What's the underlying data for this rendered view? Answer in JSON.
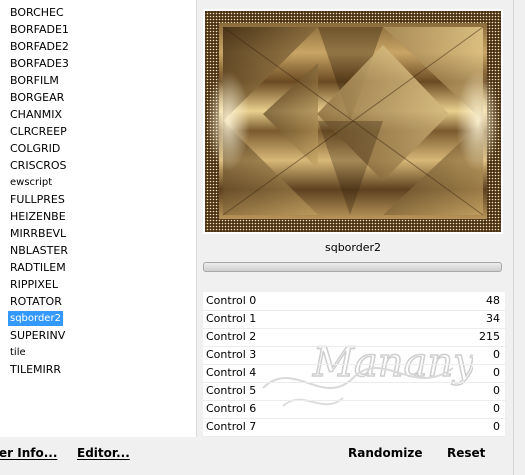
{
  "filter_list": {
    "items": [
      {
        "label": "BORCHEC"
      },
      {
        "label": "BORFADE1"
      },
      {
        "label": "BORFADE2"
      },
      {
        "label": "BORFADE3"
      },
      {
        "label": "BORFILM"
      },
      {
        "label": "BORGEAR"
      },
      {
        "label": "CHANMIX"
      },
      {
        "label": "CLRCREEP"
      },
      {
        "label": "COLGRID"
      },
      {
        "label": "CRISCROS"
      },
      {
        "label": "ewscript"
      },
      {
        "label": "FULLPRES"
      },
      {
        "label": "HEIZENBE"
      },
      {
        "label": "MIRRBEVL"
      },
      {
        "label": "NBLASTER"
      },
      {
        "label": "RADTILEM"
      },
      {
        "label": "RIPPIXEL"
      },
      {
        "label": "ROTATOR"
      },
      {
        "label": "sqborder2",
        "selected": true
      },
      {
        "label": "SUPERINV"
      },
      {
        "label": "tile"
      },
      {
        "label": "TILEMIRR"
      }
    ]
  },
  "left_buttons": {
    "info_label": "er Info...",
    "editor_label": "Editor..."
  },
  "filter_name": "sqborder2",
  "controls": [
    {
      "label": "Control 0",
      "value": "48"
    },
    {
      "label": "Control 1",
      "value": "34"
    },
    {
      "label": "Control 2",
      "value": "215"
    },
    {
      "label": "Control 3",
      "value": "0"
    },
    {
      "label": "Control 4",
      "value": "0"
    },
    {
      "label": "Control 5",
      "value": "0"
    },
    {
      "label": "Control 6",
      "value": "0"
    },
    {
      "label": "Control 7",
      "value": "0"
    }
  ],
  "buttons": {
    "randomize_label": "Randomize",
    "reset_label": "Reset"
  },
  "watermark_text": "Manany",
  "colors": {
    "selection": "#3399ff",
    "frame_dark": "#4a3010",
    "gold": "#f2d898"
  }
}
